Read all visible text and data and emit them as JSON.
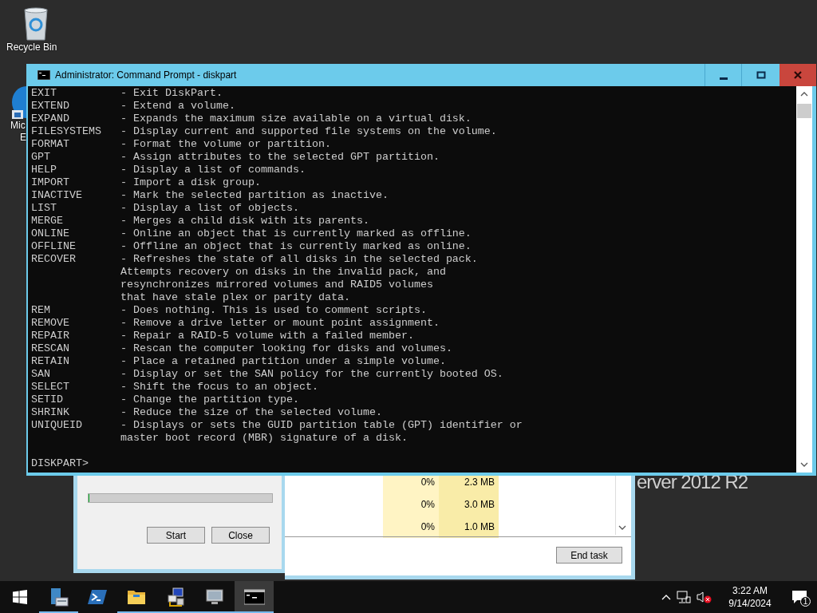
{
  "desktop_icons": [
    {
      "kind": "recycle-bin",
      "label_lines": [
        "Recycle Bin"
      ]
    },
    {
      "kind": "browser",
      "label_lines": [
        "Mic",
        "E"
      ]
    }
  ],
  "desktop_text": "erver 2012 R2",
  "back_dialog": {
    "progress": {
      "level": 0
    },
    "buttons": [
      "Start",
      "Close"
    ]
  },
  "task_manager": {
    "rows": [
      {
        "cpu": "0%",
        "memory": "2.3 MB"
      },
      {
        "cpu": "0%",
        "memory": "3.0 MB"
      },
      {
        "cpu": "0%",
        "memory": "1.0 MB"
      }
    ],
    "end_task": "End task"
  },
  "console_window": {
    "title": "Administrator: Command Prompt - diskpart",
    "lines": [
      {
        "kind": "command",
        "command": "EXIT",
        "text": "- Exit DiskPart."
      },
      {
        "kind": "command",
        "command": "EXTEND",
        "text": "- Extend a volume."
      },
      {
        "kind": "command",
        "command": "EXPAND",
        "text": "- Expands the maximum size available on a virtual disk."
      },
      {
        "kind": "command",
        "command": "FILESYSTEMS",
        "text": "- Display current and supported file systems on the volume."
      },
      {
        "kind": "command",
        "command": "FORMAT",
        "text": "- Format the volume or partition."
      },
      {
        "kind": "command",
        "command": "GPT",
        "text": "- Assign attributes to the selected GPT partition."
      },
      {
        "kind": "command",
        "command": "HELP",
        "text": "- Display a list of commands."
      },
      {
        "kind": "command",
        "command": "IMPORT",
        "text": "- Import a disk group."
      },
      {
        "kind": "command",
        "command": "INACTIVE",
        "text": "- Mark the selected partition as inactive."
      },
      {
        "kind": "command",
        "command": "LIST",
        "text": "- Display a list of objects."
      },
      {
        "kind": "command",
        "command": "MERGE",
        "text": "- Merges a child disk with its parents."
      },
      {
        "kind": "command",
        "command": "ONLINE",
        "text": "- Online an object that is currently marked as offline."
      },
      {
        "kind": "command",
        "command": "OFFLINE",
        "text": "- Offline an object that is currently marked as online."
      },
      {
        "kind": "command",
        "command": "RECOVER",
        "text": "- Refreshes the state of all disks in the selected pack."
      },
      {
        "kind": "continuation",
        "text": "Attempts recovery on disks in the invalid pack, and"
      },
      {
        "kind": "continuation",
        "text": "resynchronizes mirrored volumes and RAID5 volumes"
      },
      {
        "kind": "continuation",
        "text": "that have stale plex or parity data."
      },
      {
        "kind": "command",
        "command": "REM",
        "text": "- Does nothing. This is used to comment scripts."
      },
      {
        "kind": "command",
        "command": "REMOVE",
        "text": "- Remove a drive letter or mount point assignment."
      },
      {
        "kind": "command",
        "command": "REPAIR",
        "text": "- Repair a RAID-5 volume with a failed member."
      },
      {
        "kind": "command",
        "command": "RESCAN",
        "text": "- Rescan the computer looking for disks and volumes."
      },
      {
        "kind": "command",
        "command": "RETAIN",
        "text": "- Place a retained partition under a simple volume."
      },
      {
        "kind": "command",
        "command": "SAN",
        "text": "- Display or set the SAN policy for the currently booted OS."
      },
      {
        "kind": "command",
        "command": "SELECT",
        "text": "- Shift the focus to an object."
      },
      {
        "kind": "command",
        "command": "SETID",
        "text": "- Change the partition type."
      },
      {
        "kind": "command",
        "command": "SHRINK",
        "text": "- Reduce the size of the selected volume."
      },
      {
        "kind": "command",
        "command": "UNIQUEID",
        "text": "- Displays or sets the GUID partition table (GPT) identifier or"
      },
      {
        "kind": "continuation",
        "text": "master boot record (MBR) signature of a disk."
      }
    ],
    "prompt": "DISKPART>"
  },
  "taskbar": {
    "apps": [
      {
        "kind": "server-manager",
        "running": true,
        "selected": false
      },
      {
        "kind": "powershell",
        "running": false,
        "selected": false
      },
      {
        "kind": "folder",
        "running": true,
        "selected": false
      },
      {
        "kind": "network-computer",
        "running": true,
        "selected": false
      },
      {
        "kind": "monitor",
        "running": true,
        "selected": false
      },
      {
        "kind": "console",
        "running": true,
        "selected": true
      }
    ],
    "tray": {
      "muted": true
    },
    "time": "3:22 AM",
    "date": "9/14/2024",
    "notifications": "1"
  }
}
